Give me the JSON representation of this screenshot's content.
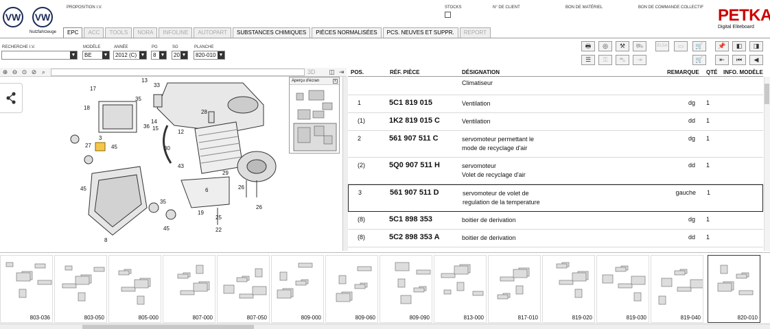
{
  "header": {
    "logo_text": "VW",
    "logo_caption": "Nutzfahrzeuge",
    "proposition_label": "PROPOSITION I.V.",
    "stocks_label": "STOCKS",
    "client_label": "N° DE CLIENT",
    "material_label": "BON DE MATÉRIEL",
    "order_label": "BON DE COMMANDE COLLECTIF",
    "brand": "PETKA",
    "brand_sub": "Digital Eliteboard"
  },
  "tabs": [
    {
      "label": "EPC",
      "state": "active"
    },
    {
      "label": "ACC",
      "state": "disabled"
    },
    {
      "label": "TOOLS",
      "state": "disabled"
    },
    {
      "label": "NORA",
      "state": "disabled"
    },
    {
      "label": "INFOLINE",
      "state": "disabled"
    },
    {
      "label": "AUTOPART",
      "state": "disabled"
    },
    {
      "label": "SUBSTANCES CHIMIQUES",
      "state": "enabled"
    },
    {
      "label": "PIÈCES NORMALISÉES",
      "state": "enabled"
    },
    {
      "label": "PCS. NEUVES ET SUPPR.",
      "state": "enabled"
    },
    {
      "label": "REPORT",
      "state": "disabled"
    }
  ],
  "filters": {
    "search_label": "RECHERCHE I.V.",
    "model_label": "MODÈLE",
    "model_value": "BE",
    "year_label": "ANNÉE",
    "year_value": "2012 (C)",
    "pg_label": "PG",
    "pg_value": "8",
    "sg_label": "SG",
    "sg_value": "20",
    "plate_label": "PLANCHE",
    "plate_value": "820-010"
  },
  "toolbar_icons": [
    "print-icon",
    "print-preview-icon",
    "car-tool-icon",
    "car-outline-icon",
    "elsa-icon",
    "catalog-icon",
    "cart-icon",
    "pin-icon",
    "prev-plate-icon",
    "next-plate-icon",
    "list-icon",
    "key-icon",
    "car-front-icon",
    "arrow-right-icon",
    "cart-add-icon",
    "first-icon",
    "prev-icon",
    "next-icon"
  ],
  "toolbar_labels": {
    "elsa": "ELSA"
  },
  "diagram": {
    "preview_title": "Aperçu d'écran",
    "callouts": [
      "17",
      "13",
      "33",
      "18",
      "35",
      "14",
      "36",
      "15",
      "28",
      "12",
      "27",
      "3",
      "45",
      "30",
      "43",
      "45",
      "26",
      "29",
      "19",
      "25",
      "22",
      "6",
      "26",
      "35",
      "8",
      "45"
    ]
  },
  "table": {
    "headers": {
      "pos": "POS.",
      "ref": "RÉF. PIÈCE",
      "designation": "DÉSIGNATION",
      "remark": "REMARQUE",
      "qty": "QTÉ",
      "info": "INFO. MODÈLE"
    },
    "group_title": "Climatiseur",
    "rows": [
      {
        "pos": "1",
        "ref": "5C1 819 015",
        "line1": "Ventilation",
        "line2": "",
        "remark": "dg",
        "qty": "1"
      },
      {
        "pos": "(1)",
        "ref": "1K2 819 015 C",
        "line1": "Ventilation",
        "line2": "",
        "remark": "dd",
        "qty": "1"
      },
      {
        "pos": "2",
        "ref": "561 907 511 C",
        "line1": "servomoteur permettant le",
        "line2": "mode de recyclage d'air",
        "remark": "dg",
        "qty": "1"
      },
      {
        "pos": "(2)",
        "ref": "5Q0 907 511 H",
        "line1": "servomoteur",
        "line2": "Volet de recyclage d'air",
        "remark": "dd",
        "qty": "1"
      },
      {
        "pos": "3",
        "ref": "561 907 511 D",
        "line1": "servomoteur de volet de",
        "line2": "regulation de la temperature",
        "remark": "gauche",
        "qty": "1"
      },
      {
        "pos": "(8)",
        "ref": "5C1 898 353",
        "line1": "boitier de derivation",
        "line2": "",
        "remark": "dg",
        "qty": "1"
      },
      {
        "pos": "(8)",
        "ref": "5C2 898 353 A",
        "line1": "boitier de derivation",
        "line2": "",
        "remark": "dd",
        "qty": "1"
      }
    ]
  },
  "thumbnails": [
    "803-036",
    "803-050",
    "805-000",
    "807-000",
    "807-050",
    "809-000",
    "809-060",
    "809-090",
    "813-000",
    "817-010",
    "819-020",
    "819-030",
    "819-040",
    "820-010"
  ],
  "selected_thumbnail": "820-010"
}
